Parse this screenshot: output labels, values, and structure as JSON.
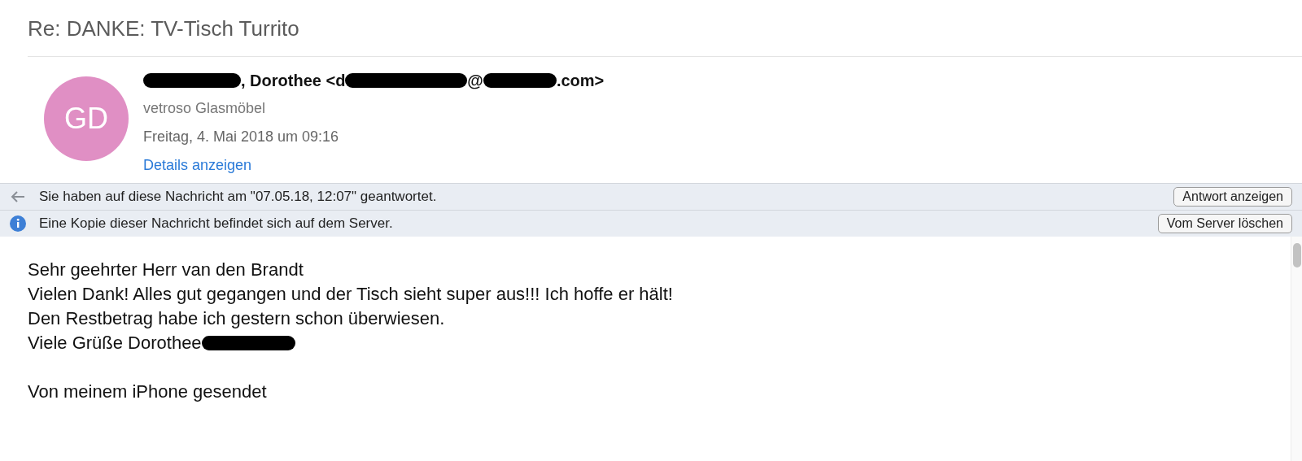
{
  "subject": "Re: DANKE: TV-Tisch Turrito",
  "sender": {
    "avatar_initials": "GD",
    "parts": [
      {
        "kind": "redacted"
      },
      {
        "kind": "text",
        "text": ", Dorothee <d"
      },
      {
        "kind": "redacted"
      },
      {
        "kind": "text",
        "text": "@"
      },
      {
        "kind": "redacted"
      },
      {
        "kind": "text",
        "text": ".com>"
      }
    ],
    "organization": "vetroso Glasmöbel",
    "date": "Freitag, 4. Mai 2018 um 09:16",
    "details_link": "Details anzeigen"
  },
  "notices": [
    {
      "kind": "replied",
      "text": "Sie haben auf diese Nachricht am \"07.05.18, 12:07\" geantwortet.",
      "button": "Antwort anzeigen"
    },
    {
      "kind": "info",
      "text": "Eine Kopie dieser Nachricht befindet sich auf dem Server.",
      "button": "Vom Server löschen"
    }
  ],
  "body": [
    {
      "text": "Sehr geehrter Herr van den Brandt"
    },
    {
      "text": "Vielen Dank! Alles gut gegangen und der Tisch sieht super aus!!! Ich hoffe er hält!"
    },
    {
      "text": "Den Restbetrag habe ich gestern schon überwiesen."
    },
    {
      "text": "Viele Grüße Dorothee",
      "redacted_tail": true
    },
    {
      "kind": "blank"
    },
    {
      "text": "Von meinem iPhone gesendet"
    }
  ]
}
